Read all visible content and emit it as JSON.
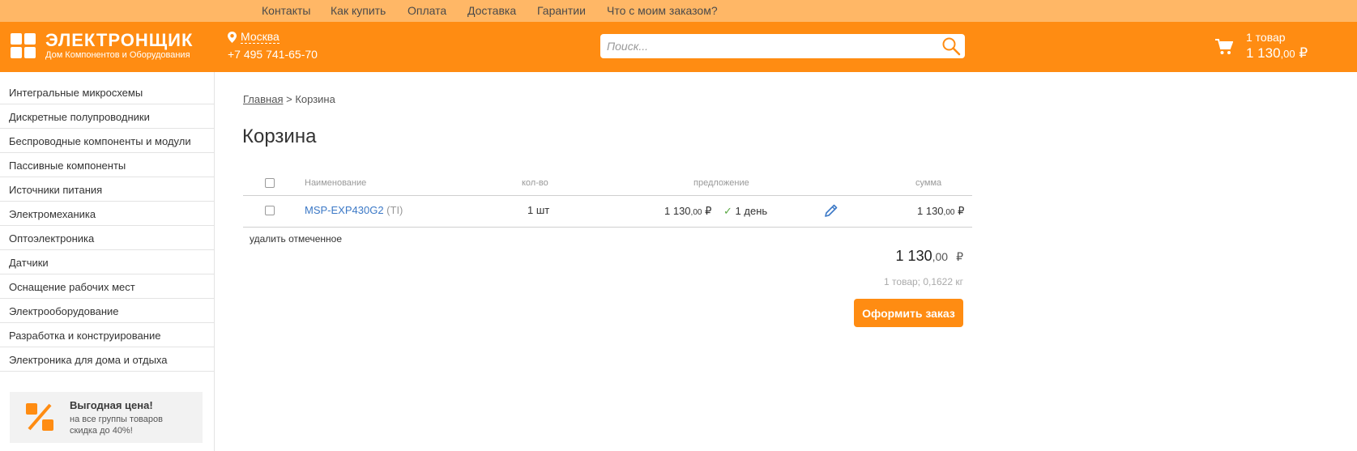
{
  "topnav": [
    "Контакты",
    "Как купить",
    "Оплата",
    "Доставка",
    "Гарантии",
    "Что с моим заказом?"
  ],
  "header": {
    "logo_title": "ЭЛЕКТРОНЩИК",
    "logo_subtitle": "Дом Компонентов и Оборудования",
    "city": "Москва",
    "phone": "+7 495 741-65-70",
    "search_placeholder": "Поиск...",
    "cart_count": "1 товар",
    "cart_total_int": "1 130",
    "cart_total_dec": ",00",
    "currency": "₽"
  },
  "sidebar": {
    "items": [
      "Интегральные микросхемы",
      "Дискретные полупроводники",
      "Беспроводные компоненты и модули",
      "Пассивные компоненты",
      "Источники питания",
      "Электромеханика",
      "Оптоэлектроника",
      "Датчики",
      "Оснащение рабочих мест",
      "Электрооборудование",
      "Разработка и конструирование",
      "Электроника для дома и отдыха"
    ],
    "promo_title": "Выгодная цена!",
    "promo_line1": "на все группы товаров",
    "promo_line2": "скидка до 40%!"
  },
  "breadcrumb": {
    "home": "Главная",
    "sep": ">",
    "current": "Корзина"
  },
  "page_title": "Корзина",
  "cart": {
    "columns": {
      "name": "Наименование",
      "qty": "кол-во",
      "offer": "предложение",
      "sum": "сумма"
    },
    "rows": [
      {
        "name": "MSP-EXP430G2",
        "manufacturer": "(TI)",
        "qty": "1 шт",
        "price_int": "1 130",
        "price_dec": ",00",
        "delivery": "1 день",
        "sum_int": "1 130",
        "sum_dec": ",00"
      }
    ],
    "delete_label": "удалить отмеченное",
    "total_int": "1 130",
    "total_dec": ",00",
    "summary": "1 товар; 0,1622 кг",
    "checkout_label": "Оформить заказ"
  },
  "colors": {
    "accent": "#ff8c12",
    "topbar": "#ffb766",
    "link": "#3b78c6"
  }
}
